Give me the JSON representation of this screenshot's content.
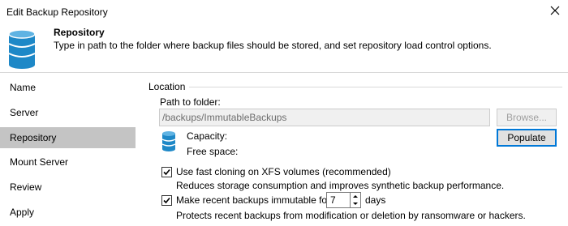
{
  "window": {
    "title": "Edit Backup Repository"
  },
  "header": {
    "title": "Repository",
    "description": "Type in path to the folder where backup files should be stored, and set repository load control options."
  },
  "sidebar": {
    "items": [
      {
        "label": "Name",
        "active": false
      },
      {
        "label": "Server",
        "active": false
      },
      {
        "label": "Repository",
        "active": true
      },
      {
        "label": "Mount Server",
        "active": false
      },
      {
        "label": "Review",
        "active": false
      },
      {
        "label": "Apply",
        "active": false
      }
    ]
  },
  "location": {
    "section_label": "Location",
    "path_label": "Path to folder:",
    "path_value": "/backups/ImmutableBackups",
    "browse_label": "Browse...",
    "capacity_label": "Capacity:",
    "free_space_label": "Free space:",
    "populate_label": "Populate"
  },
  "options": {
    "fast_cloning": {
      "label": "Use fast cloning on XFS volumes (recommended)",
      "description": "Reduces storage consumption and improves synthetic backup performance.",
      "checked": true
    },
    "immutable": {
      "label": "Make recent backups immutable for:",
      "days_value": "7",
      "days_label": "days",
      "description": "Protects recent backups from modification or deletion by ransomware or hackers.",
      "checked": true
    }
  },
  "colors": {
    "accent": "#0078d7",
    "db_icon": "#1e88c7",
    "sidebar_active": "#c4c4c4"
  }
}
